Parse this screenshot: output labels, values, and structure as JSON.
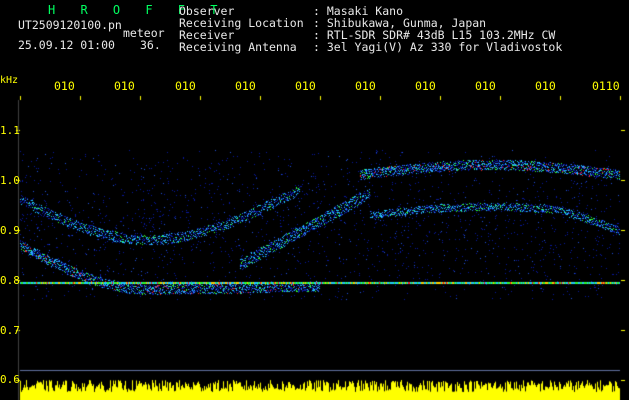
{
  "header": {
    "title": "H R O F F T",
    "file_name": "UT2509120100.pn",
    "meteor_label": "meteor",
    "datetime": "25.09.12 01:00",
    "meteor_count": "36.",
    "info": [
      {
        "label": "Observer",
        "value": ": Masaki Kano"
      },
      {
        "label": "Receiving Location",
        "value": ": Shibukawa, Gunma, Japan"
      },
      {
        "label": "Receiver",
        "value": ": RTL-SDR SDR# 43dB L15 103.2MHz CW"
      },
      {
        "label": "Receiving Antenna",
        "value": ": 3el Yagi(V) Az 330 for Vladivostok"
      }
    ]
  },
  "axis": {
    "y_unit": "kHz",
    "y_ticks": [
      "1.1",
      "1.0",
      "0.9",
      "0.8",
      "0.7",
      "0.6"
    ],
    "x_ticks": [
      "010",
      "010",
      "010",
      "010",
      "010",
      "010",
      "010",
      "010",
      "010",
      "0110"
    ]
  },
  "colors": {
    "background": "#000000",
    "text_yellow": "#ffff00",
    "text_green": "#00ff60",
    "tick_mark": "#ffff00",
    "signal_low": "#0a1aa0",
    "signal_mid": "#20d0ff",
    "signal_high": "#30ff30",
    "signal_peak": "#ff2020",
    "level_bar": "#ffff00"
  }
}
